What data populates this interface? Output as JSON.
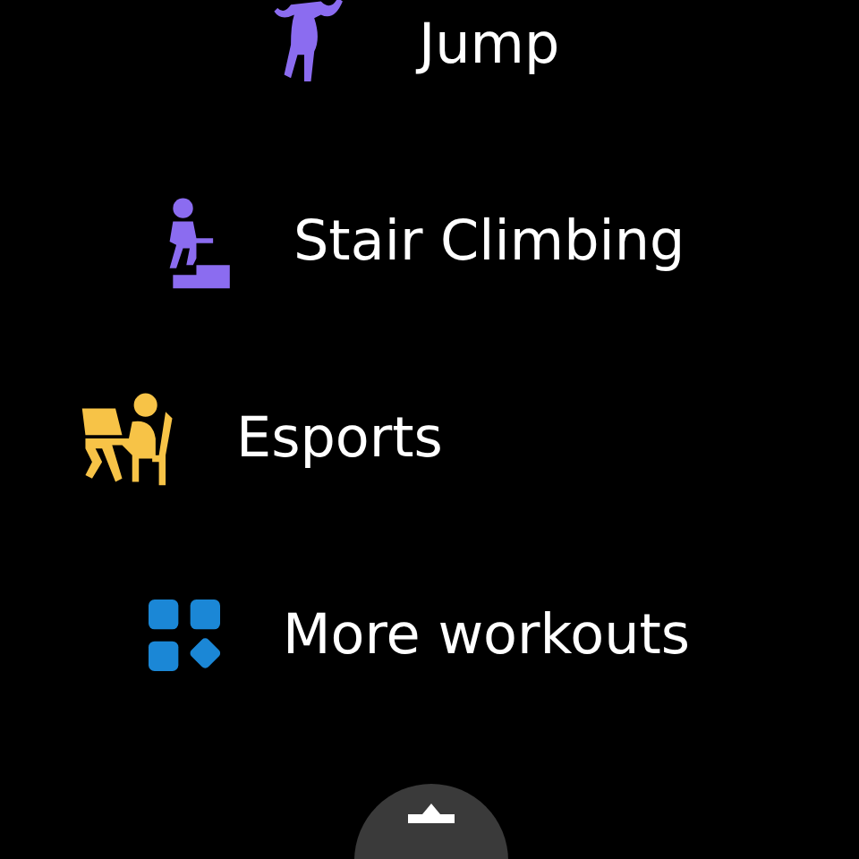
{
  "workouts": [
    {
      "kind": "jumping",
      "label": "Jump",
      "color": "#8b6cf0"
    },
    {
      "kind": "stairs",
      "label": "Stair Climbing",
      "color": "#8b6cf0"
    },
    {
      "kind": "esports",
      "label": "Esports",
      "color": "#f7c347"
    },
    {
      "kind": "more",
      "label": "More workouts",
      "color": "#1b87d6"
    }
  ]
}
